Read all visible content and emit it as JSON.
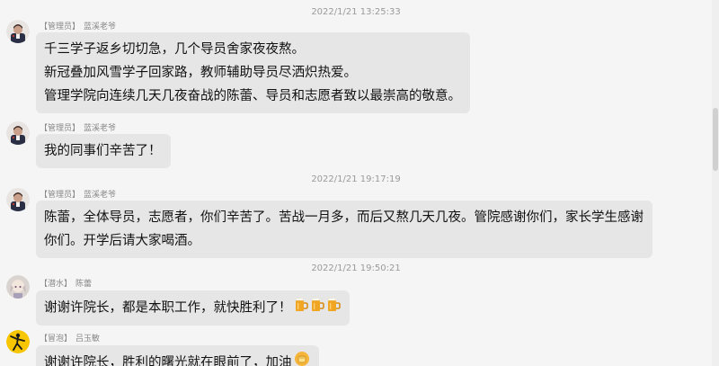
{
  "timestamps": {
    "t1": "2022/1/21 13:25:33",
    "t2": "2022/1/21 19:17:19",
    "t3": "2022/1/21 19:50:21"
  },
  "messages": [
    {
      "role": "【管理员】",
      "name": "蓝溪老爷",
      "lines": [
        "千三学子返乡切切急，几个导员舍家夜夜熬。",
        "新冠叠加风雪学子回家路，教师辅助导员尽洒炽热爱。",
        "管理学院向连续几天几夜奋战的陈蕾、导员和志愿者致以最崇高的敬意。"
      ]
    },
    {
      "role": "【管理员】",
      "name": "蓝溪老爷",
      "lines": [
        "我的同事们辛苦了！"
      ]
    },
    {
      "role": "【管理员】",
      "name": "蓝溪老爷",
      "lines": [
        "陈蕾，全体导员，志愿者，你们辛苦了。苦战一月多，而后又熬几天几夜。管院感谢你们，家长学生感谢",
        "你们。开学后请大家喝酒。"
      ]
    },
    {
      "role": "【潜水】",
      "name": "陈蕾",
      "lines": [
        "谢谢许院长，都是本职工作，就快胜利了！"
      ],
      "emojis": [
        "beer-icon",
        "beer-icon",
        "beer-icon"
      ]
    },
    {
      "role": "【冒泡】",
      "name": "吕玉敏",
      "lines": [
        "谢谢许院长，胜利的曙光就在眼前了，加油"
      ],
      "emojis": [
        "fist-icon"
      ]
    }
  ],
  "colors": {
    "background": "#f5f5f5",
    "bubble": "#e6e6e6",
    "meta_text": "#888888",
    "timestamp_text": "#9a9a9a"
  }
}
